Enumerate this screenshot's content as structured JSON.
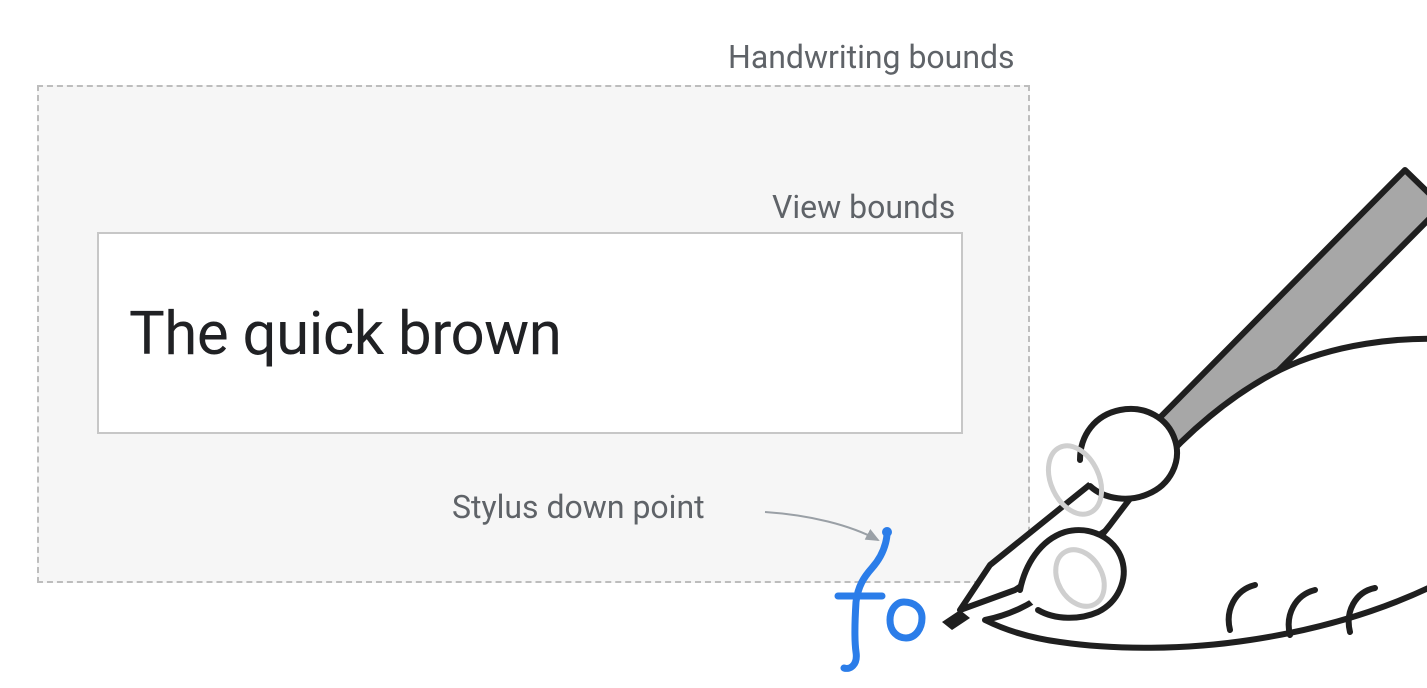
{
  "labels": {
    "handwriting_bounds": "Handwriting bounds",
    "view_bounds": "View bounds",
    "stylus_down_point": "Stylus down point"
  },
  "input": {
    "text": "The quick brown"
  },
  "handwriting": {
    "ink_text": "fo",
    "ink_color": "#2b7de9"
  },
  "colors": {
    "label": "#5f6368",
    "dash": "#bdbdbd",
    "view_border": "#c7c7c7",
    "ink": "#2b7de9",
    "stylus_fill": "#a7a7a7"
  }
}
